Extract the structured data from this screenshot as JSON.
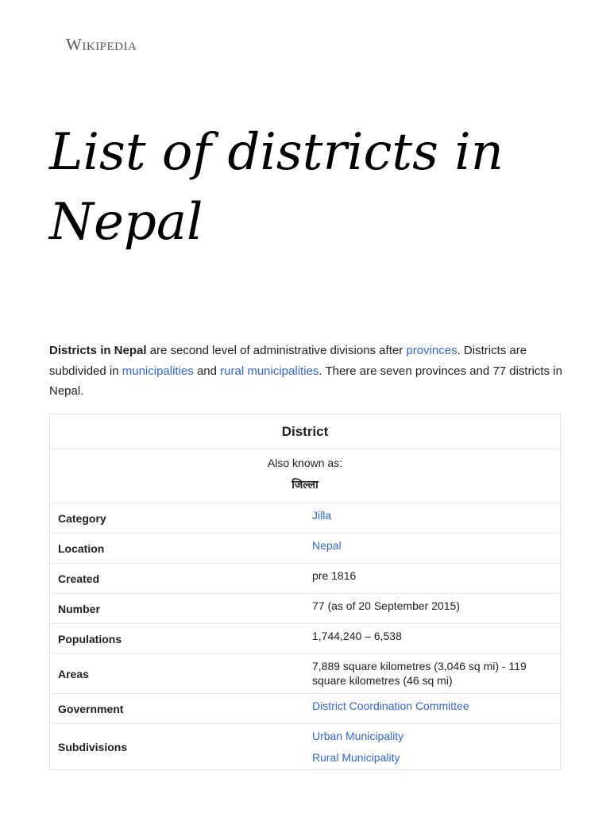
{
  "site": {
    "wordmark": "Wikipedia"
  },
  "page": {
    "title": "List of districts in Nepal"
  },
  "intro": {
    "bold_term": "Districts in Nepal",
    "text1": " are second level of administrative divisions after ",
    "link_provinces": "provinces",
    "text2": ". Districts are subdivided in ",
    "link_municipalities": "municipalities",
    "text3": " and ",
    "link_rural": "rural municipalities",
    "text4": ". There are seven provinces and 77 districts in Nepal."
  },
  "infobox": {
    "heading": "District",
    "aka_label": "Also known as:",
    "aka_value": "जिल्ला",
    "rows": [
      {
        "label": "Category",
        "value": "Jilla",
        "link": true
      },
      {
        "label": "Location",
        "value": "Nepal",
        "link": true
      },
      {
        "label": "Created",
        "value": "pre 1816",
        "link": false
      },
      {
        "label": "Number",
        "value": "77 (as of 20 September 2015)",
        "link": false
      },
      {
        "label": "Populations",
        "value": "1,744,240 – 6,538",
        "link": false
      },
      {
        "label": "Areas",
        "value": "7,889 square kilometres (3,046 sq mi) - 119 square kilometres (46 sq mi)",
        "link": false
      },
      {
        "label": "Government",
        "value": "District Coordination Committee",
        "link": true
      },
      {
        "label": "Subdivisions",
        "values": [
          "Urban Municipality",
          "Rural Municipality"
        ],
        "link": true
      }
    ]
  },
  "colors": {
    "link": "#3366cc",
    "text": "#202122",
    "border": "#dddddd"
  }
}
